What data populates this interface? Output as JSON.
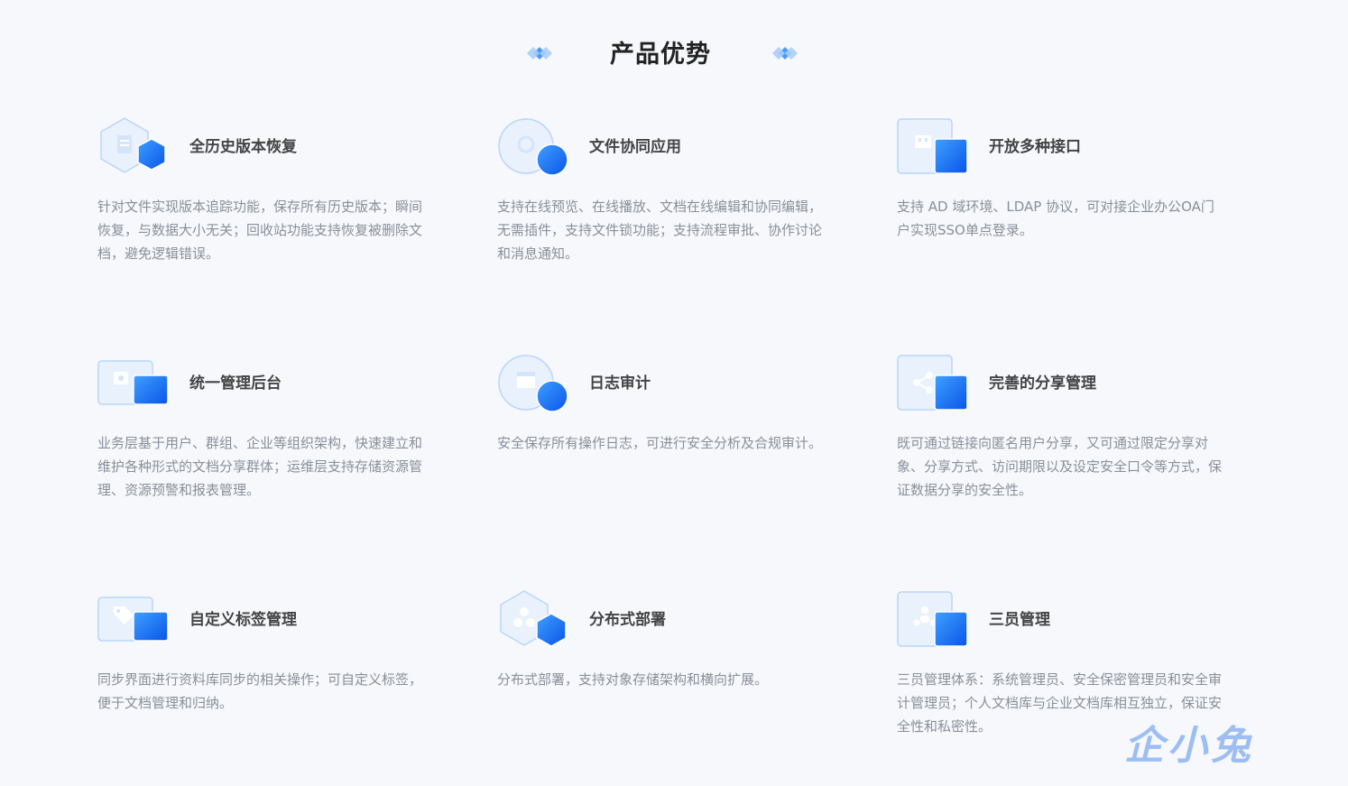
{
  "header": {
    "title": "产品优势"
  },
  "cards": [
    {
      "title": "全历史版本恢复",
      "desc": "针对文件实现版本追踪功能，保存所有历史版本；瞬间恢复，与数据大小无关；回收站功能支持恢复被删除文档，避免逻辑错误。",
      "icon": "hexagon-document-icon"
    },
    {
      "title": "文件协同应用",
      "desc": "支持在线预览、在线播放、文档在线编辑和协同编辑，无需插件，支持文件锁功能；支持流程审批、协作讨论和消息通知。",
      "icon": "circle-collaboration-icon"
    },
    {
      "title": "开放多种接口",
      "desc": "支持 AD 域环境、LDAP 协议，可对接企业办公OA门户实现SSO单点登录。",
      "icon": "interface-plug-icon"
    },
    {
      "title": "统一管理后台",
      "desc": "业务层基于用户、群组、企业等组织架构，快速建立和维护各种形式的文档分享群体；运维层支持存储资源管理、资源预警和报表管理。",
      "icon": "admin-console-icon"
    },
    {
      "title": "日志审计",
      "desc": "安全保存所有操作日志，可进行安全分析及合规审计。",
      "icon": "circle-log-icon"
    },
    {
      "title": "完善的分享管理",
      "desc": "既可通过链接向匿名用户分享，又可通过限定分享对象、分享方式、访问期限以及设定安全口令等方式，保证数据分享的安全性。",
      "icon": "share-icon"
    },
    {
      "title": "自定义标签管理",
      "desc": "同步界面进行资料库同步的相关操作；可自定义标签，便于文档管理和归纳。",
      "icon": "tag-icon"
    },
    {
      "title": "分布式部署",
      "desc": "分布式部署，支持对象存储架构和横向扩展。",
      "icon": "hexagon-nodes-icon"
    },
    {
      "title": "三员管理",
      "desc": "三员管理体系：系统管理员、安全保密管理员和安全审计管理员；个人文档库与企业文档库相互独立，保证安全性和私密性。",
      "icon": "users-icon"
    }
  ],
  "watermark": "企小兔",
  "colors": {
    "accent": "#1a73f5",
    "accent_light": "#9cc3ff",
    "icon_bg": "#e9f1fd"
  }
}
